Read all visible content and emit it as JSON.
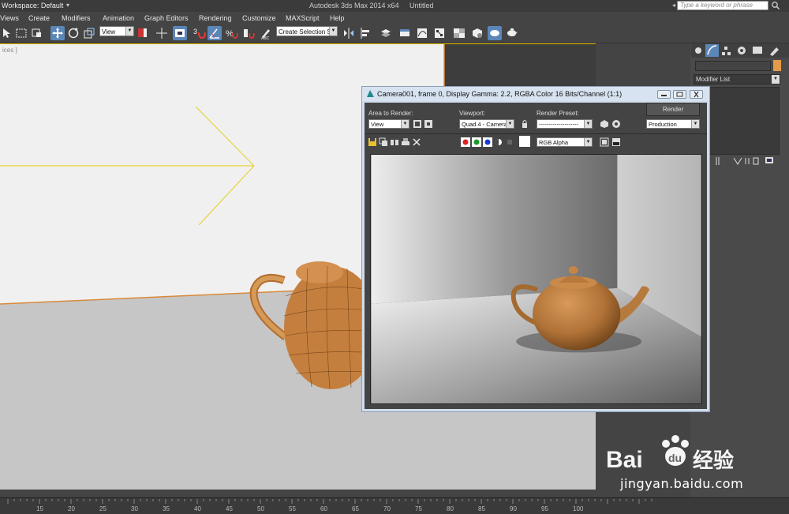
{
  "titlebar": {
    "workspace": "Workspace: Default",
    "app_title": "Autodesk 3ds Max  2014 x64",
    "doc_title": "Untitled",
    "search_placeholder": "Type a keyword or phrase"
  },
  "menu": {
    "items": [
      "Views",
      "Create",
      "Modifiers",
      "Animation",
      "Graph Editors",
      "Rendering",
      "Customize",
      "MAXScript",
      "Help"
    ]
  },
  "toolbar": {
    "ref_coord": "View",
    "selection_set": "Create Selection Se",
    "snap_label": "3"
  },
  "viewport": {
    "label": "ices ]"
  },
  "command_panel": {
    "modifier_list": "Modifier List",
    "object_color": "#e49a48"
  },
  "render_window": {
    "title": "Camera001, frame 0, Display Gamma: 2.2, RGBA Color 16 Bits/Channel (1:1)",
    "area_label": "Area to Render:",
    "area_value": "View",
    "viewport_label": "Viewport:",
    "viewport_value": "Quad 4 - Camera(",
    "preset_label": "Render Preset:",
    "preset_value": "--------------------",
    "render_button": "Render",
    "production_value": "Production",
    "channel_value": "RGB Alpha"
  },
  "timeline": {
    "ticks": [
      "15",
      "20",
      "25",
      "30",
      "35",
      "40",
      "45",
      "50",
      "55",
      "60",
      "65",
      "70",
      "75",
      "80",
      "85",
      "90",
      "95",
      "100"
    ]
  },
  "watermark": {
    "brand": "Bai",
    "brand_suffix": "经验",
    "url": "jingyan.baidu.com"
  },
  "colors": {
    "teapot": "#c47f3e",
    "highlight": "#5b86b8"
  }
}
